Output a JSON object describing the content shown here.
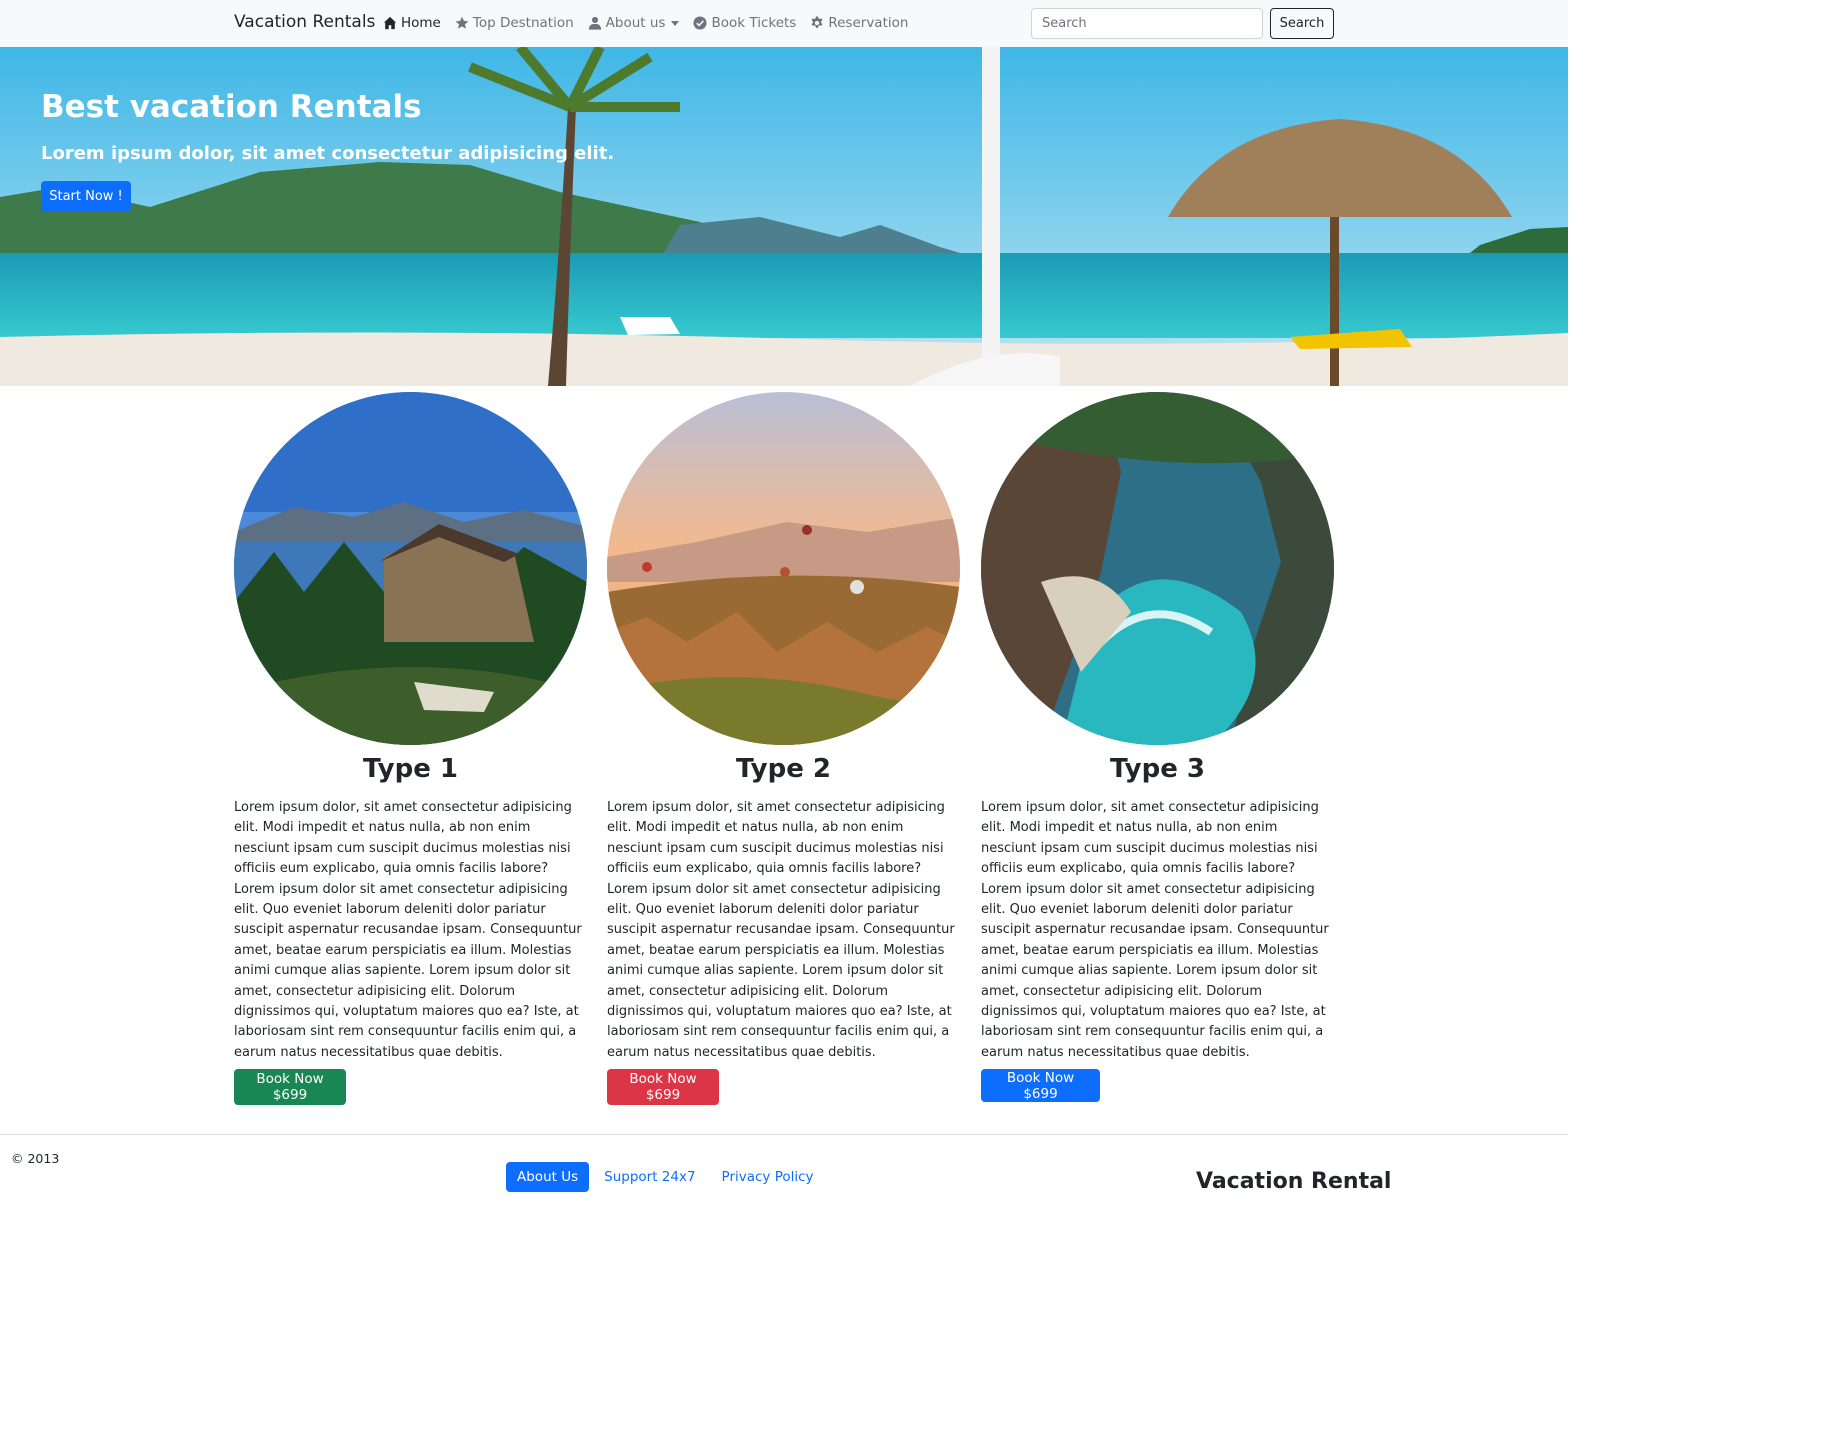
{
  "navbar": {
    "brand": "Vacation Rentals",
    "links": [
      {
        "label": "Home",
        "icon": "house-icon",
        "active": true
      },
      {
        "label": "Top Destnation",
        "icon": "star-icon"
      },
      {
        "label": "About us",
        "icon": "user-icon",
        "dropdown": true
      },
      {
        "label": "Book Tickets",
        "icon": "check-circle-icon"
      },
      {
        "label": "Reservation",
        "icon": "gear-icon"
      }
    ],
    "search_placeholder": "Search",
    "search_button": "Search"
  },
  "hero": {
    "title": "Best vacation Rentals",
    "subtitle": "Lorem ipsum dolor, sit amet consectetur adipisicing elit.",
    "button": "Start Now !"
  },
  "cards": [
    {
      "title": "Type 1",
      "text": "Lorem ipsum dolor, sit amet consectetur adipisicing elit. Modi impedit et natus nulla, ab non enim nesciunt ipsam cum suscipit ducimus molestias nisi officiis eum explicabo, quia omnis facilis labore? Lorem ipsum dolor sit amet consectetur adipisicing elit. Quo eveniet laborum deleniti dolor pariatur suscipit aspernatur recusandae ipsam. Consequuntur amet, beatae earum perspiciatis ea illum. Molestias animi cumque alias sapiente. Lorem ipsum dolor sit amet, consectetur adipisicing elit. Dolorum dignissimos qui, voluptatum maiores quo ea? Iste, at laboriosam sint rem consequuntur facilis enim qui, a earum natus necessitatibus quae debitis.",
      "button": "Book Now $699",
      "button_color": "#198754"
    },
    {
      "title": "Type 2",
      "text": "Lorem ipsum dolor, sit amet consectetur adipisicing elit. Modi impedit et natus nulla, ab non enim nesciunt ipsam cum suscipit ducimus molestias nisi officiis eum explicabo, quia omnis facilis labore? Lorem ipsum dolor sit amet consectetur adipisicing elit. Quo eveniet laborum deleniti dolor pariatur suscipit aspernatur recusandae ipsam. Consequuntur amet, beatae earum perspiciatis ea illum. Molestias animi cumque alias sapiente. Lorem ipsum dolor sit amet, consectetur adipisicing elit. Dolorum dignissimos qui, voluptatum maiores quo ea? Iste, at laboriosam sint rem consequuntur facilis enim qui, a earum natus necessitatibus quae debitis.",
      "button": "Book Now $699",
      "button_color": "#dc3545"
    },
    {
      "title": "Type 3",
      "text": "Lorem ipsum dolor, sit amet consectetur adipisicing elit. Modi impedit et natus nulla, ab non enim nesciunt ipsam cum suscipit ducimus molestias nisi officiis eum explicabo, quia omnis facilis labore? Lorem ipsum dolor sit amet consectetur adipisicing elit. Quo eveniet laborum deleniti dolor pariatur suscipit aspernatur recusandae ipsam. Consequuntur amet, beatae earum perspiciatis ea illum. Molestias animi cumque alias sapiente. Lorem ipsum dolor sit amet, consectetur adipisicing elit. Dolorum dignissimos qui, voluptatum maiores quo ea? Iste, at laboriosam sint rem consequuntur facilis enim qui, a earum natus necessitatibus quae debitis.",
      "button": "Book Now $699",
      "button_color": "#0d6efd"
    }
  ],
  "footer": {
    "copyright": "© 2013",
    "links": [
      "About Us",
      "Support 24x7",
      "Privacy Policy"
    ],
    "brand": "Vacation Rental"
  }
}
